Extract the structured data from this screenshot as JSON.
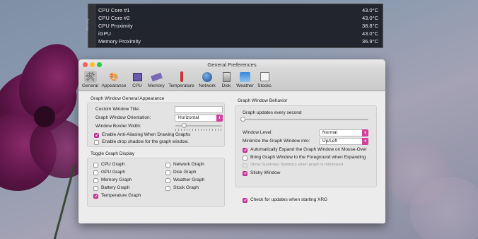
{
  "overlay": {
    "side_label": "Memory",
    "rows": [
      {
        "label": "CPU Core #1",
        "value": "43.0°C"
      },
      {
        "label": "CPU Core #2",
        "value": "43.0°C"
      },
      {
        "label": "CPU Proximity",
        "value": "38.8°C"
      },
      {
        "label": "iGPU",
        "value": "43.0°C"
      },
      {
        "label": "Memory Proximity",
        "value": "36.9°C"
      }
    ]
  },
  "window": {
    "title": "General Preferences",
    "toolbar": [
      {
        "label": "General",
        "icon": "tools-icon"
      },
      {
        "label": "Appearance",
        "icon": "palette-icon"
      },
      {
        "label": "CPU",
        "icon": "cpu-icon"
      },
      {
        "label": "Memory",
        "icon": "memory-icon"
      },
      {
        "label": "Temperature",
        "icon": "thermometer-icon"
      },
      {
        "label": "Network",
        "icon": "globe-icon"
      },
      {
        "label": "Disk",
        "icon": "disk-icon"
      },
      {
        "label": "Weather",
        "icon": "weather-icon"
      },
      {
        "label": "Stocks",
        "icon": "stocks-icon"
      }
    ],
    "left": {
      "appearance_title": "Graph Window General Appearance",
      "custom_title_label": "Custom Window Title:",
      "custom_title_value": "",
      "orientation_label": "Graph Window Orientation:",
      "orientation_value": "Horizontal",
      "border_width_label": "Window Border Width:",
      "anti_aliasing_label": "Enable Anti-Aliasing When Drawing Graphs",
      "anti_aliasing_checked": true,
      "drop_shadow_label": "Enable drop shadow for the graph window.",
      "drop_shadow_checked": false,
      "toggle_title": "Toggle Graph Display",
      "graphs": [
        {
          "label": "CPU Graph",
          "checked": false
        },
        {
          "label": "GPU Graph",
          "checked": false
        },
        {
          "label": "Memory Graph",
          "checked": false
        },
        {
          "label": "Battery Graph",
          "checked": false
        },
        {
          "label": "Temperature Graph",
          "checked": true
        },
        {
          "label": "Network Graph",
          "checked": false
        },
        {
          "label": "Disk Graph",
          "checked": false
        },
        {
          "label": "Weather Graph",
          "checked": false
        },
        {
          "label": "Stock Graph",
          "checked": false
        }
      ]
    },
    "right": {
      "behavior_title": "Graph Window Behavior",
      "updates_label": "Graph updates every second",
      "level_label": "Window Level:",
      "level_value": "Normal",
      "minimize_label": "Minimize the Graph Window into:",
      "minimize_value": "Up/Left",
      "options": [
        {
          "label": "Automatically Expand the Graph Window on Mouse-Over",
          "checked": true,
          "disabled": false
        },
        {
          "label": "Bring Graph Window to the Foreground when Expanding",
          "checked": false,
          "disabled": false
        },
        {
          "label": "Show Summary Statistics when graph is minimized",
          "checked": false,
          "disabled": true
        },
        {
          "label": "Sticky Window",
          "checked": true,
          "disabled": false
        }
      ],
      "check_updates_label": "Check for updates when starting XRG",
      "check_updates_checked": true
    }
  }
}
